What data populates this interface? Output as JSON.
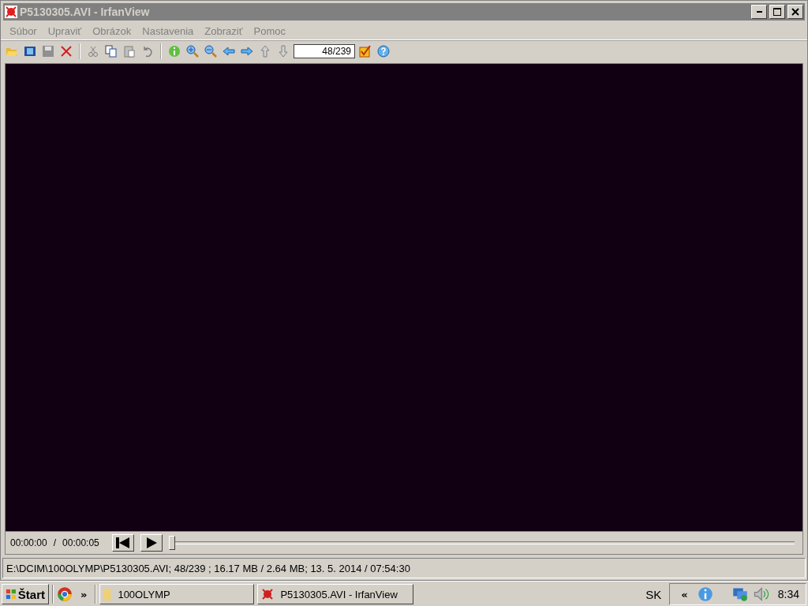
{
  "window": {
    "title": "P5130305.AVI - IrfanView"
  },
  "menu": [
    "Súbor",
    "Upraviť",
    "Obrázok",
    "Nastavenia",
    "Zobraziť",
    "Pomoc"
  ],
  "toolbar": {
    "page_counter": "48/239"
  },
  "player": {
    "current_time": "00:00:00",
    "separator": "/",
    "total_time": "00:00:05",
    "level": 0
  },
  "status_bar": "E:\\DCIM\\100OLYMP\\P5130305.AVI; 48/239 ; 16.17 MB / 2.64 MB; 13. 5. 2014 / 07:54:30",
  "taskbar": {
    "start": "Štart",
    "more": "»",
    "tasks": [
      "100OLYMP",
      "P5130305.AVI - IrfanView"
    ],
    "language": "SK",
    "tray_expand": "«",
    "clock": "8:34"
  }
}
